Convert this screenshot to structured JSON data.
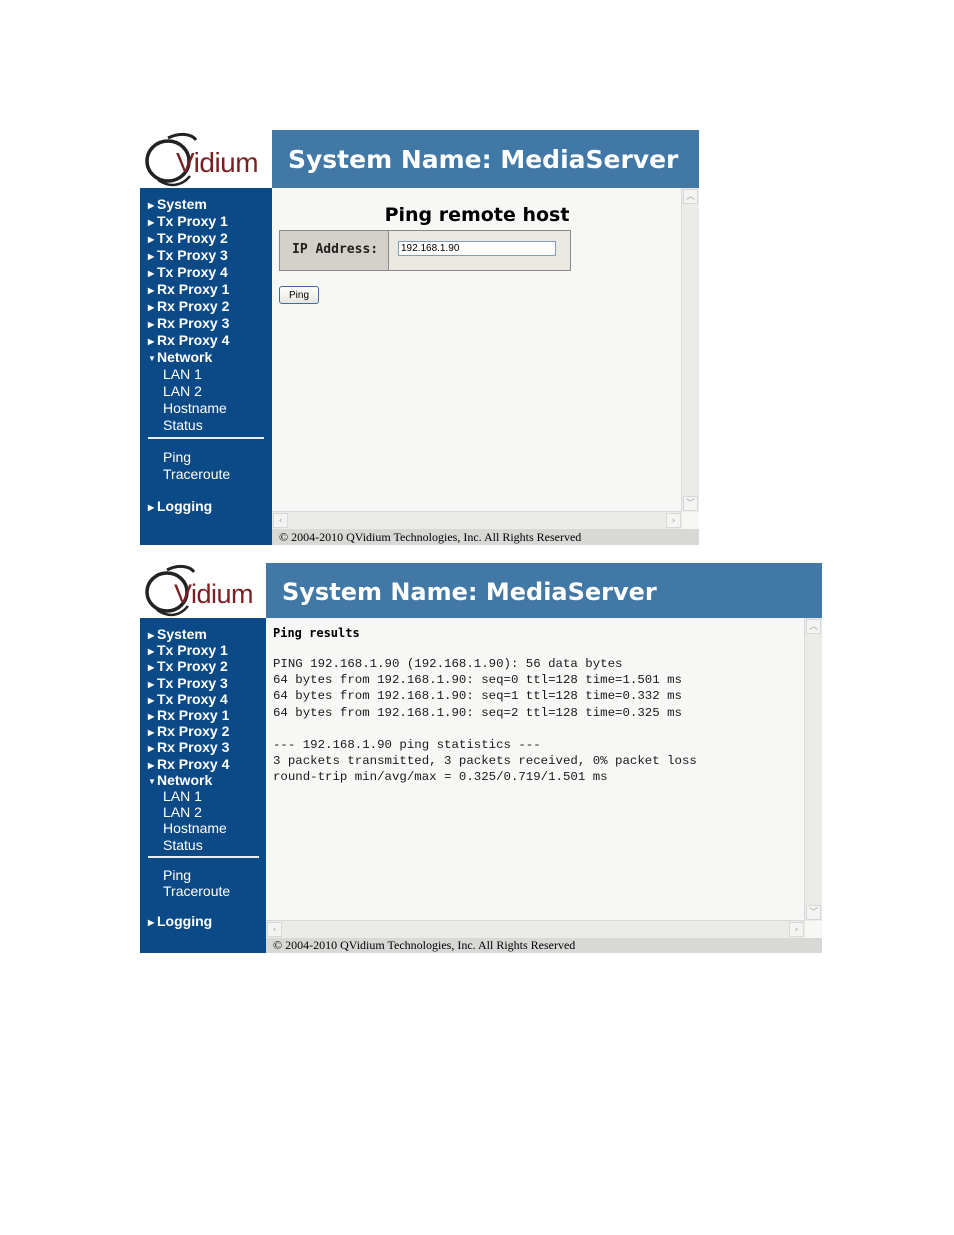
{
  "brand": {
    "logo_text": "Vidium",
    "logo_color": "#7a1f24"
  },
  "colors": {
    "header_bg": "#4178a6",
    "sidebar_bg": "#0b4a86",
    "content_bg": "#f7f7f5"
  },
  "header": {
    "title": "System Name: MediaServer"
  },
  "sidebar": {
    "items": [
      {
        "label": "System",
        "icon": "triangle-right-icon"
      },
      {
        "label": "Tx Proxy 1",
        "icon": "triangle-right-icon"
      },
      {
        "label": "Tx Proxy 2",
        "icon": "triangle-right-icon"
      },
      {
        "label": "Tx Proxy 3",
        "icon": "triangle-right-icon"
      },
      {
        "label": "Tx Proxy 4",
        "icon": "triangle-right-icon"
      },
      {
        "label": "Rx Proxy 1",
        "icon": "triangle-right-icon"
      },
      {
        "label": "Rx Proxy 2",
        "icon": "triangle-right-icon"
      },
      {
        "label": "Rx Proxy 3",
        "icon": "triangle-right-icon"
      },
      {
        "label": "Rx Proxy 4",
        "icon": "triangle-right-icon"
      },
      {
        "label": "Network",
        "icon": "triangle-down-icon"
      }
    ],
    "network_sub": [
      "LAN 1",
      "LAN 2",
      "Hostname",
      "Status"
    ],
    "tools": [
      "Ping",
      "Traceroute"
    ],
    "logging": "Logging"
  },
  "ping_form": {
    "title": "Ping remote host",
    "ip_label": "IP Address:",
    "ip_value": "192.168.1.90",
    "button": "Ping"
  },
  "ping_results": {
    "title": "Ping results",
    "lines": [
      "PING 192.168.1.90 (192.168.1.90): 56 data bytes",
      "64 bytes from 192.168.1.90: seq=0 ttl=128 time=1.501 ms",
      "64 bytes from 192.168.1.90: seq=1 ttl=128 time=0.332 ms",
      "64 bytes from 192.168.1.90: seq=2 ttl=128 time=0.325 ms",
      "",
      "--- 192.168.1.90 ping statistics ---",
      "3 packets transmitted, 3 packets received, 0% packet loss",
      "round-trip min/avg/max = 0.325/0.719/1.501 ms"
    ]
  },
  "footer": {
    "text": "© 2004-2010 QVidium Technologies, Inc.   All Rights Reserved"
  }
}
